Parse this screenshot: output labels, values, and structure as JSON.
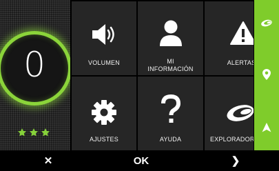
{
  "speed": {
    "value": "0",
    "rating": 3
  },
  "menu": {
    "items": [
      {
        "label": "VOLUMEN",
        "icon": "speaker-icon"
      },
      {
        "label_line1": "MI",
        "label_line2": "INFORMACIÓN",
        "icon": "user-icon"
      },
      {
        "label": "ALERTAS",
        "icon": "alert-icon"
      },
      {
        "label": "AJUSTES",
        "icon": "gear-icon"
      },
      {
        "label": "AYUDA",
        "icon": "question-icon"
      },
      {
        "label": "EXPLORADORES",
        "icon": "explorers-icon"
      }
    ]
  },
  "sidebar": {
    "items": [
      {
        "icon": "explorers-icon"
      },
      {
        "icon": "location-pin-icon"
      },
      {
        "icon": "navigation-arrow-icon"
      }
    ]
  },
  "bottom": {
    "cancel_label": "✕",
    "ok_label": "OK",
    "next_label": "❯"
  },
  "colors": {
    "accent": "#7fcc2b",
    "tile": "#262626",
    "background": "#000000"
  }
}
